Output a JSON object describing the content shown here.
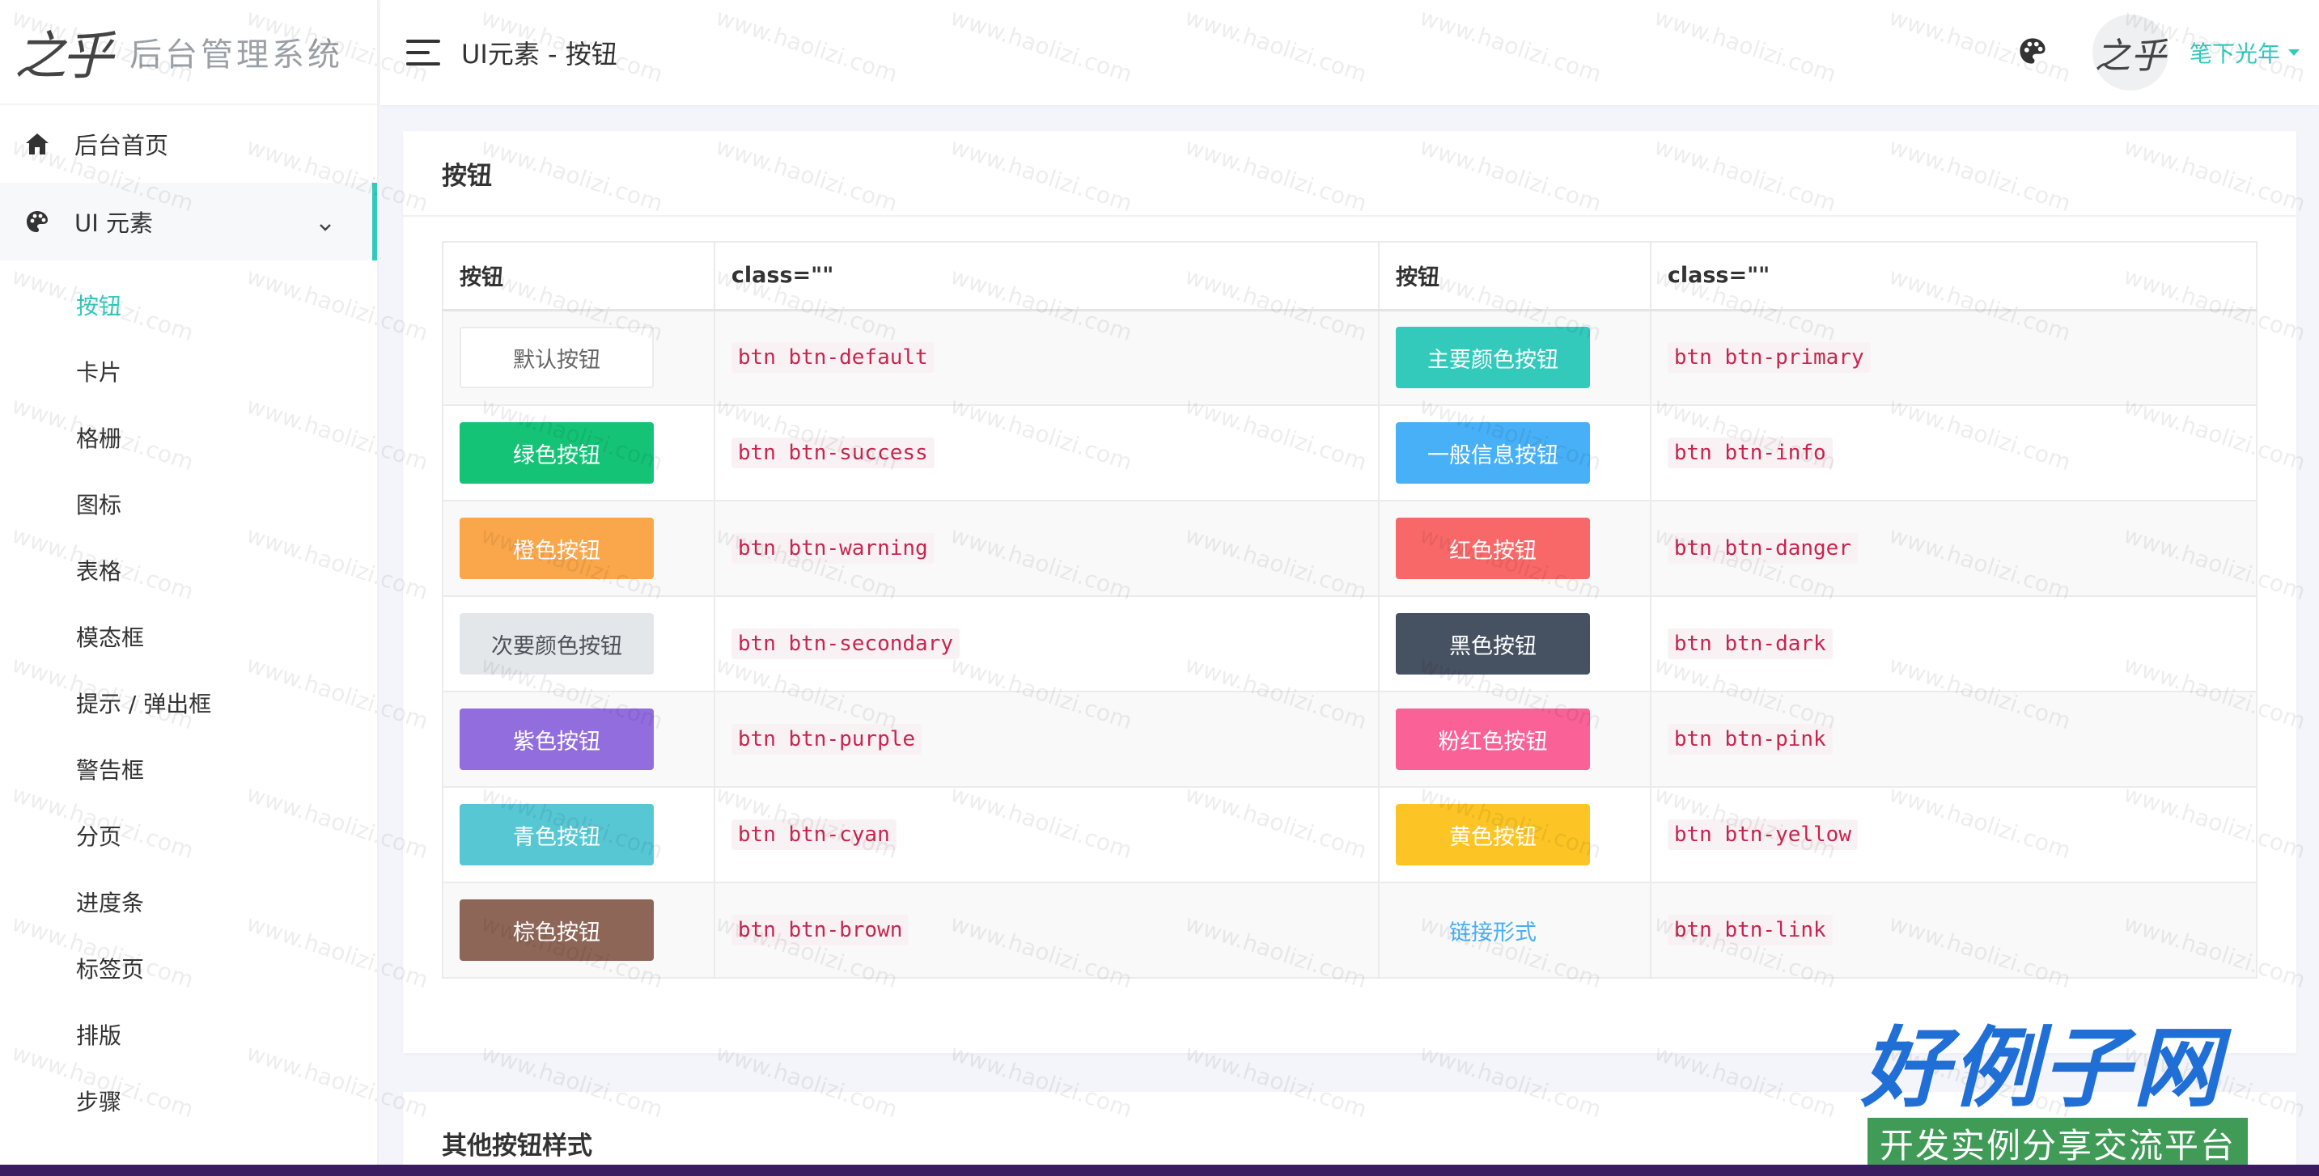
{
  "brand": {
    "mark": "之乎",
    "name": "后台管理系统"
  },
  "sidebar": {
    "items": [
      {
        "label": "后台首页",
        "icon": "home-icon"
      },
      {
        "label": "UI 元素",
        "icon": "palette-icon"
      }
    ],
    "submenu": [
      "按钮",
      "卡片",
      "格栅",
      "图标",
      "表格",
      "模态框",
      "提示 / 弹出框",
      "警告框",
      "分页",
      "进度条",
      "标签页",
      "排版",
      "步骤"
    ]
  },
  "header": {
    "title": "UI元素 - 按钮",
    "avatar_text": "之乎",
    "user": "笔下光年"
  },
  "card1": {
    "title": "按钮"
  },
  "table": {
    "headers": [
      "按钮",
      "class=\"\"",
      "按钮",
      "class=\"\""
    ],
    "rows": [
      {
        "l_btn": "默认按钮",
        "l_class": "btn btn-default",
        "r_btn": "主要颜色按钮",
        "r_class": "btn btn-primary"
      },
      {
        "l_btn": "绿色按钮",
        "l_class": "btn btn-success",
        "r_btn": "一般信息按钮",
        "r_class": "btn btn-info"
      },
      {
        "l_btn": "橙色按钮",
        "l_class": "btn btn-warning",
        "r_btn": "红色按钮",
        "r_class": "btn btn-danger"
      },
      {
        "l_btn": "次要颜色按钮",
        "l_class": "btn btn-secondary",
        "r_btn": "黑色按钮",
        "r_class": "btn btn-dark"
      },
      {
        "l_btn": "紫色按钮",
        "l_class": "btn btn-purple",
        "r_btn": "粉红色按钮",
        "r_class": "btn btn-pink"
      },
      {
        "l_btn": "青色按钮",
        "l_class": "btn btn-cyan",
        "r_btn": "黄色按钮",
        "r_class": "btn btn-yellow"
      },
      {
        "l_btn": "棕色按钮",
        "l_class": "btn btn-brown",
        "r_btn": "链接形式",
        "r_class": "btn btn-link"
      }
    ]
  },
  "card2": {
    "title": "其他按钮样式"
  },
  "watermark": {
    "text": "www.haolizi.com",
    "badge_big": "好例子网",
    "badge_small": "开发实例分享交流平台"
  },
  "colors": {
    "accent": "#33cabb",
    "primary": "#33cabb",
    "success": "#15c377",
    "info": "#48b0f7",
    "warning": "#faa64b",
    "danger": "#f96868",
    "dark": "#465161",
    "purple": "#926dde",
    "pink": "#f96197",
    "cyan": "#57c7d4",
    "yellow": "#fcc525",
    "brown": "#8d6658"
  }
}
